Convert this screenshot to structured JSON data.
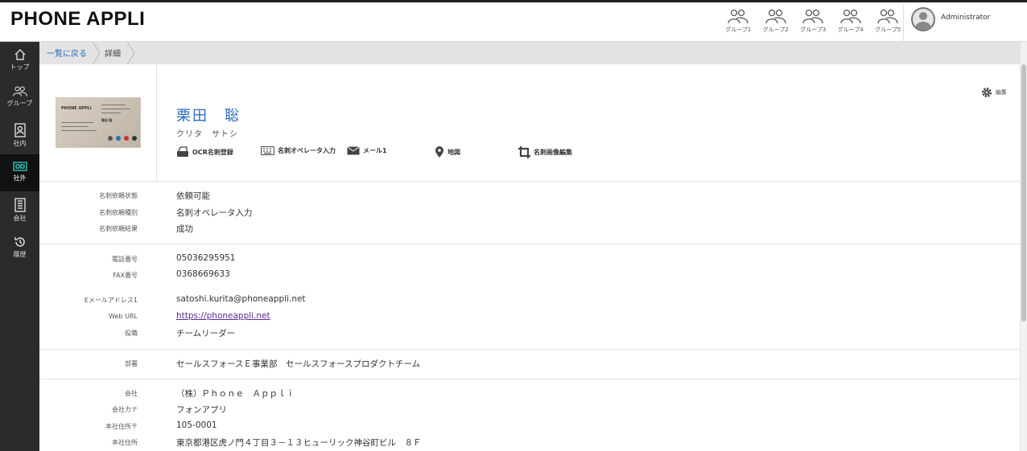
{
  "app": {
    "logo": "PHONE APPLI"
  },
  "header": {
    "groups": [
      {
        "label": "グループ1"
      },
      {
        "label": "グループ2"
      },
      {
        "label": "グループ3"
      },
      {
        "label": "グループ4"
      },
      {
        "label": "グループ5"
      }
    ],
    "user": {
      "name": "Administrator"
    }
  },
  "sidebar": {
    "items": [
      {
        "label": "トップ",
        "icon": "home-icon"
      },
      {
        "label": "グループ",
        "icon": "group-icon"
      },
      {
        "label": "社内",
        "icon": "directory-icon"
      },
      {
        "label": "社外",
        "icon": "card-icon",
        "active": true
      },
      {
        "label": "会社",
        "icon": "building-icon"
      },
      {
        "label": "履歴",
        "icon": "history-icon"
      }
    ]
  },
  "breadcrumb": {
    "back": "一覧に戻る",
    "current": "詳細"
  },
  "contact": {
    "name": "栗田　聡",
    "kana": "クリタ　サトシ",
    "edit_label": "編集"
  },
  "actions": [
    {
      "label": "OCR名刺登録",
      "icon": "scanner-icon"
    },
    {
      "label": "名刺オペレータ入力",
      "icon": "keyboard-icon"
    },
    {
      "label": "メール1",
      "icon": "mail-icon"
    },
    {
      "label": "地図",
      "icon": "map-pin-icon"
    },
    {
      "label": "名刺画像編集",
      "icon": "crop-icon"
    }
  ],
  "card_image": {
    "company": "PHONE APPLI",
    "name": "栗田 聡"
  },
  "sections": {
    "request": [
      {
        "label": "名刺依頼状態",
        "value": "依頼可能"
      },
      {
        "label": "名刺依頼種別",
        "value": "名刺オペレータ入力"
      },
      {
        "label": "名刺依頼結果",
        "value": "成功"
      }
    ],
    "contact": [
      {
        "label": "電話番号",
        "value": "05036295951"
      },
      {
        "label": "FAX番号",
        "value": "0368669633"
      },
      {
        "label": "Eメールアドレス1",
        "value": "satoshi.kurita@phoneappli.net"
      },
      {
        "label": "Web URL",
        "value": "https://phoneappli.net"
      },
      {
        "label": "役職",
        "value": "チームリーダー"
      }
    ],
    "dept": [
      {
        "label": "部署",
        "value": "セールスフォースＥ事業部　セールスフォースプロダクトチーム"
      }
    ],
    "company": [
      {
        "label": "会社",
        "value": "（株）Ｐｈｏｎｅ　Ａｐｐｌｉ"
      },
      {
        "label": "会社カナ",
        "value": "フォンアプリ"
      },
      {
        "label": "本社住所〒",
        "value": "105-0001"
      },
      {
        "label": "本社住所",
        "value": "東京都港区虎ノ門４丁目３－１３ヒューリック神谷町ビル　８Ｆ"
      }
    ]
  },
  "colors": {
    "accent": "#2a6fb8",
    "sidebar": "#2b2b2b",
    "active_icon": "#2fb8b0",
    "link_visited": "#5a2b8f"
  }
}
